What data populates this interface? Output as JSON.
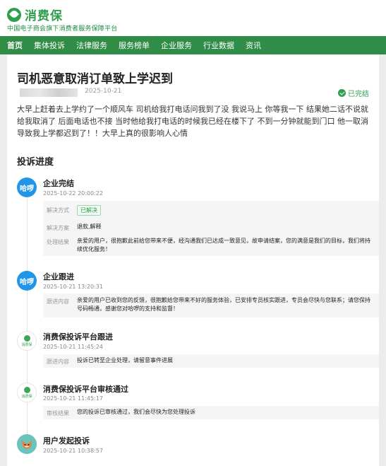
{
  "brand": {
    "name": "消费保",
    "subtitle": "中国电子商会旗下消费者服务保障平台",
    "color": "#2e9e4f"
  },
  "nav": {
    "items": [
      "首页",
      "集体投诉",
      "法律服务",
      "服务榜单",
      "企业服务",
      "行业数据",
      "资讯"
    ]
  },
  "complaint": {
    "title": "司机恶意取消订单致上学迟到",
    "date": "2025-10-21",
    "status": "已完结",
    "body": "大早上赶着去上学约了一个顺风车 司机给我打电话问我到了没 我说马上 你等我一下 结果她二话不说就给我取消了 后面电话也不接 当时他给我打电话的时候我已经在楼下了 不到一分钟就能到门口 他一取消导致我上学都迟到了！！大早上真的很影响人心情"
  },
  "progress": {
    "title": "投诉进度",
    "entries": [
      {
        "avatar_label": "哈啰",
        "title": "企业完结",
        "time": "2025-10-22 20:00:22",
        "rows": [
          {
            "label": "解决方式",
            "value": "已解决"
          },
          {
            "label": "解决方案",
            "value": "退款,解释"
          },
          {
            "label": "处理结果",
            "value": "亲爱的用户，很抱歉此前给您带来不便，经沟通我们已达成一致意见，故申请结案，您的满意是我们的目标，我们将持续优化服务！"
          }
        ]
      },
      {
        "avatar_label": "哈啰",
        "title": "企业跟进",
        "time": "2025-10-21 13:20:31",
        "rows": [
          {
            "label": "跟进内容",
            "value": "亲爱的用户已收到您的反馈，很抱歉给您带来不好的服务体验，已安排专员核实跟进，专员会尽快与您联系；请您保持号码畅通，感谢您对哈啰的支持和监督！"
          }
        ]
      },
      {
        "avatar_label": "消费保",
        "title": "消费保投诉平台跟进",
        "time": "2025-10-21 11:45:24",
        "rows": [
          {
            "label": "跟进内容",
            "value": "投诉已转至企业处理，请留意事件进展"
          }
        ]
      },
      {
        "avatar_label": "消费保",
        "title": "消费保投诉平台审核通过",
        "time": "2025-10-21 11:45:17",
        "rows": [
          {
            "label": "审核结果",
            "value": "您的投诉已审核通过，我们会尽快为您处理投诉"
          }
        ]
      },
      {
        "avatar_label": "",
        "title": "用户发起投诉",
        "time": "2025-10-21 10:38:57",
        "rows": []
      }
    ]
  }
}
